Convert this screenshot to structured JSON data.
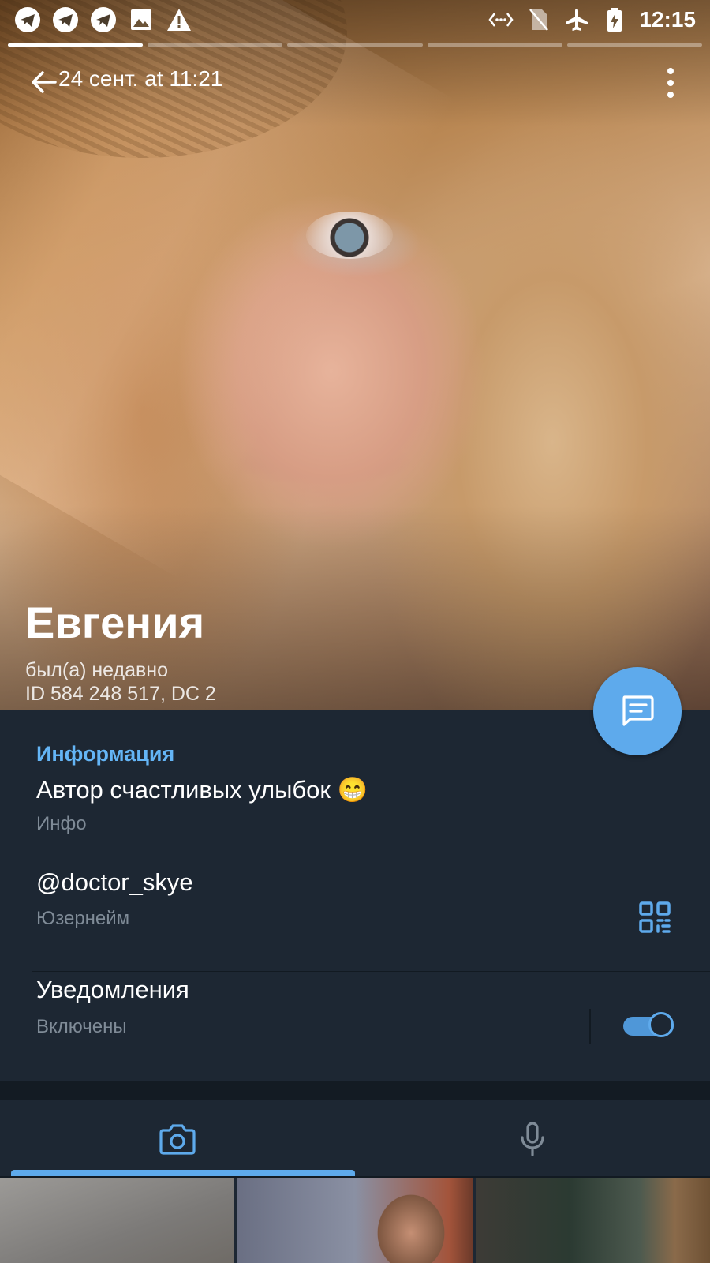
{
  "status_bar": {
    "notification_icons": [
      "telegram-icon",
      "telegram-icon",
      "telegram-icon",
      "image-icon",
      "warning-icon"
    ],
    "right_icons": [
      "data-saver-icon",
      "no-sim-icon",
      "airplane-mode-icon",
      "battery-charging-icon"
    ],
    "time": "12:15"
  },
  "story": {
    "segments": 5,
    "active_segment": 1
  },
  "toolbar": {
    "date": "24 сент. at 11:21"
  },
  "profile": {
    "name": "Евгения",
    "last_seen": "был(а) недавно",
    "id_line": "ID 584 248 517, DC 2"
  },
  "info": {
    "section_title": "Информация",
    "bio": "Автор счастливых улыбок 😁",
    "bio_label": "Инфо",
    "username": "@doctor_skye",
    "username_label": "Юзернейм",
    "notifications": "Уведомления",
    "notifications_state": "Включены",
    "notifications_enabled": true
  },
  "media_tabs": {
    "tabs": [
      "camera-icon",
      "microphone-icon"
    ],
    "selected": 0
  },
  "colors": {
    "accent": "#5eaaec",
    "background": "#1d2733",
    "section_title": "#64b5f6",
    "secondary_text": "#7f8b97"
  }
}
